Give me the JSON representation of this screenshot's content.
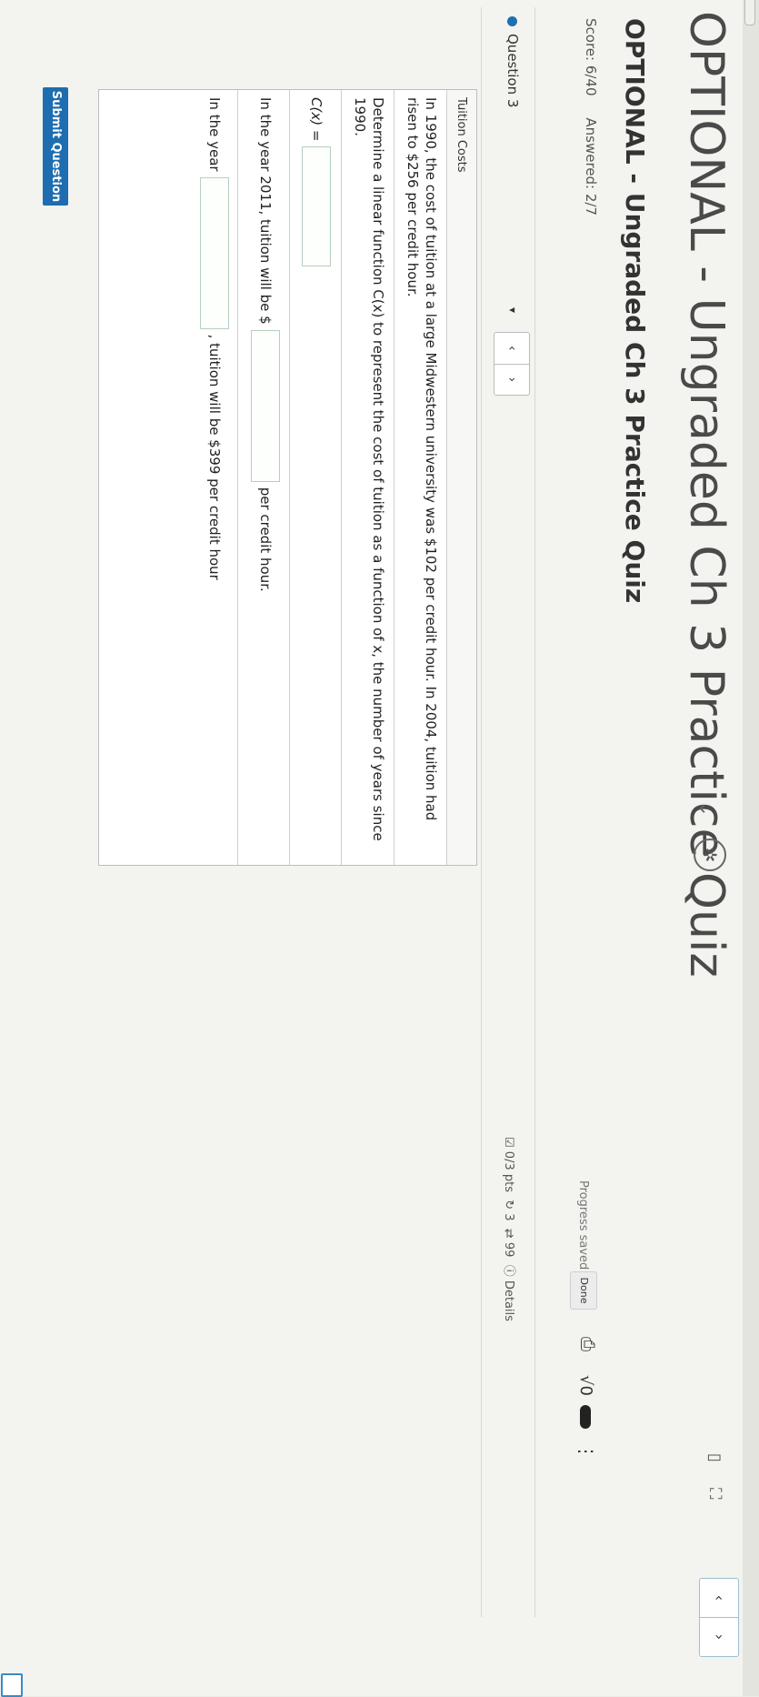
{
  "header": {
    "title": "OPTIONAL - Ungraded Ch 3 Practice Quiz",
    "title_chevron": "⌄",
    "star_icon": "✲",
    "bookmark_icon": "▯",
    "fullscreen_icon": "⛶",
    "nav_prev": "‹",
    "nav_next": "›"
  },
  "quiz": {
    "title": "OPTIONAL - Ungraded Ch 3 Practice Quiz",
    "score": "Score: 6/40",
    "answered": "Answered: 2/7",
    "progress_saved": "Progress saved",
    "done_label": "Done",
    "print_icon": "⎙",
    "sqrt_label": "√0",
    "more_icon": "⋮"
  },
  "question_nav": {
    "label": "Question 3",
    "dropdown_icon": "▾",
    "prev": "‹",
    "next": "›",
    "points": "0/3 pts",
    "retries": "3",
    "attempts": "99",
    "details": "Details"
  },
  "question": {
    "header": "Tuition Costs",
    "paragraph1": "In 1990, the cost of tuition at a large Midwestern university was $102 per credit hour. In 2004, tuition had risen to $256 per credit hour.",
    "paragraph2": "Determine a linear function C(x) to represent the cost of tuition as a function of x, the number of years since 1990.",
    "c_of_x_label": "C(x) =",
    "c_of_x_value": "",
    "year2011_prefix": "In the year 2011, tuition will be $",
    "year2011_value": "",
    "year2011_suffix": "per credit hour.",
    "year_prefix": "In the year",
    "year_value": "",
    "year_suffix": ", tuition will be $399 per credit hour"
  },
  "submit_label": "Submit Question",
  "colors": {
    "accent": "#1d6db0",
    "input_border": "#b5cfc0"
  }
}
